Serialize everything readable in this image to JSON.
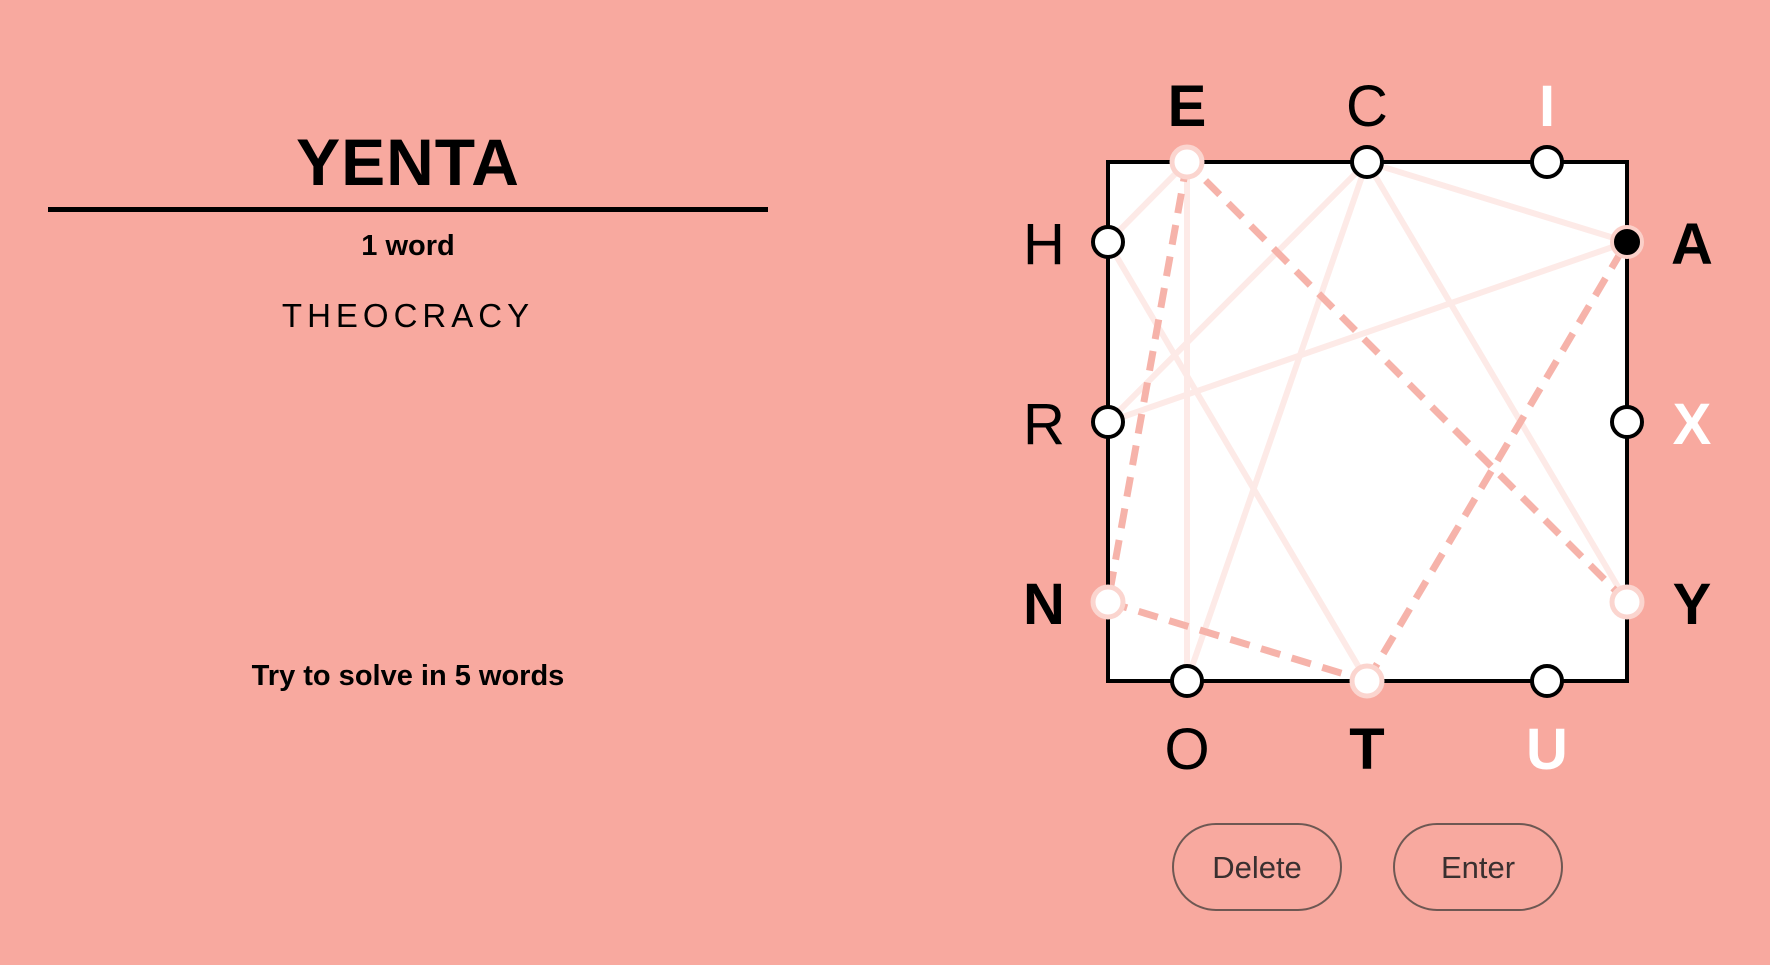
{
  "game": {
    "current_word": "YENTA",
    "word_count_label": "1 word",
    "found_words": [
      "THEOCRACY"
    ],
    "hint": "Try to solve in 5 words"
  },
  "controls": {
    "delete_label": "Delete",
    "enter_label": "Enter"
  },
  "board": {
    "sides": {
      "top": [
        "E",
        "C",
        "I"
      ],
      "left": [
        "H",
        "R",
        "N"
      ],
      "right": [
        "A",
        "X",
        "Y"
      ],
      "bottom": [
        "O",
        "T",
        "U"
      ]
    },
    "states": {
      "E": "active",
      "C": "used",
      "I": "unused",
      "H": "used",
      "R": "used",
      "N": "active",
      "A": "current",
      "X": "unused",
      "Y": "active",
      "O": "used",
      "T": "active",
      "U": "unused"
    },
    "used_paths": [
      [
        "T",
        "H",
        "E",
        "O",
        "C",
        "R",
        "A",
        "C",
        "Y"
      ]
    ],
    "current_path": [
      "Y",
      "E",
      "N",
      "T",
      "A"
    ]
  },
  "colors": {
    "background": "#f8a99f",
    "box_fill": "#ffffff",
    "used_line": "#fdeae7",
    "current_line": "#f6b3aa",
    "letter_active": "#000000",
    "letter_used": "#000000",
    "letter_unused": "#ffffff"
  }
}
